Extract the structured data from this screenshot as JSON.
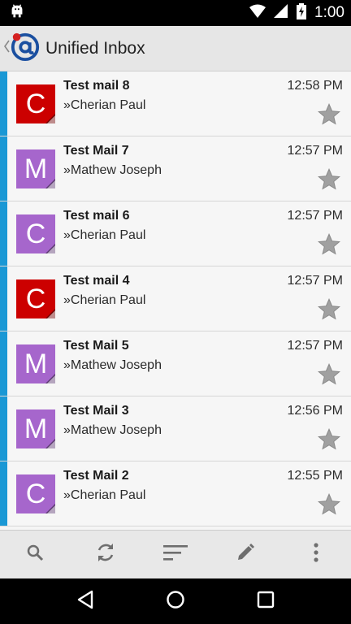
{
  "status_bar": {
    "time": "1:00"
  },
  "app_bar": {
    "title": "Unified Inbox"
  },
  "messages": [
    {
      "subject": "Test mail 8",
      "sender": "»Cherian Paul",
      "time": "12:58 PM",
      "avatar_letter": "C",
      "avatar_color": "#cc0000"
    },
    {
      "subject": "Test Mail 7",
      "sender": "»Mathew Joseph",
      "time": "12:57 PM",
      "avatar_letter": "M",
      "avatar_color": "#a666cc"
    },
    {
      "subject": "Test mail 6",
      "sender": "»Cherian Paul",
      "time": "12:57 PM",
      "avatar_letter": "C",
      "avatar_color": "#a666cc"
    },
    {
      "subject": "Test mail 4",
      "sender": "»Cherian Paul",
      "time": "12:57 PM",
      "avatar_letter": "C",
      "avatar_color": "#cc0000"
    },
    {
      "subject": "Test Mail 5",
      "sender": "»Mathew Joseph",
      "time": "12:57 PM",
      "avatar_letter": "M",
      "avatar_color": "#a666cc"
    },
    {
      "subject": "Test Mail 3",
      "sender": "»Mathew Joseph",
      "time": "12:56 PM",
      "avatar_letter": "M",
      "avatar_color": "#a666cc"
    },
    {
      "subject": "Test Mail 2",
      "sender": "»Cherian Paul",
      "time": "12:55 PM",
      "avatar_letter": "C",
      "avatar_color": "#a666cc"
    }
  ],
  "colors": {
    "unread_indicator": "#1a98d5",
    "app_bar": "#e6e6e6",
    "toolbar": "#e8e8e8",
    "icon": "#6e6e6e",
    "star": "#9a9a9a"
  },
  "icons": {
    "status_left": "android-debug-icon",
    "status_right": [
      "wifi-icon",
      "signal-icon",
      "battery-charging-icon"
    ],
    "app": "at-sign-app-icon",
    "toolbar": [
      "search-icon",
      "refresh-icon",
      "sort-icon",
      "compose-icon",
      "overflow-menu-icon"
    ],
    "navigation": [
      "back-icon",
      "home-icon",
      "recents-icon"
    ]
  }
}
